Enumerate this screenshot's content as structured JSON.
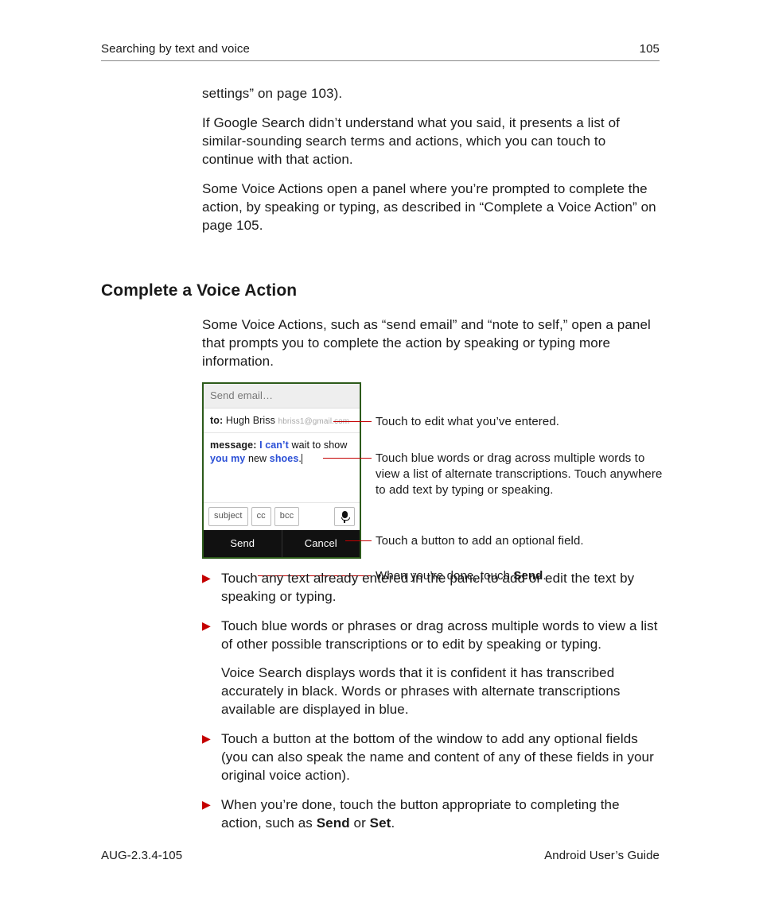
{
  "header": {
    "section": "Searching by text and voice",
    "page_number": "105"
  },
  "intro": {
    "p1": "settings” on page 103).",
    "p2": "If Google Search didn’t understand what you said, it presents a list of similar-sounding search terms and actions, which you can touch to continue with that action.",
    "p3": "Some Voice Actions open a panel where you’re prompted to complete the action, by speaking or typing, as described in “Complete a Voice Action” on page 105."
  },
  "section": {
    "title": "Complete a Voice Action",
    "lead": "Some Voice Actions, such as “send email” and “note to self,” open a panel that prompts you to complete the action by speaking or typing more information."
  },
  "panel": {
    "title": "Send email…",
    "to_label": "to:",
    "to_name": "Hugh Briss",
    "to_email": "hbriss1@gmail.com",
    "msg_label": "message:",
    "msg_w1": "I can’t",
    "msg_w2": "wait to show",
    "msg_w3": "you my",
    "msg_w4": "new",
    "msg_w5": "shoes",
    "chip_subject": "subject",
    "chip_cc": "cc",
    "chip_bcc": "bcc",
    "btn_send": "Send",
    "btn_cancel": "Cancel"
  },
  "callouts": {
    "c1": "Touch to edit what you’ve entered.",
    "c2": "Touch blue words or drag across multiple words to view a list of alternate transcriptions. Touch anywhere to add text by typing or speaking.",
    "c3": "Touch a button to add an optional field.",
    "c4_pre": "When you’re done, touch ",
    "c4_bold": "Send",
    "c4_post": "."
  },
  "bullets": {
    "b1": "Touch any text already entered in the panel to add or edit the text by speaking or typing.",
    "b2": "Touch blue words or phrases or drag across multiple words to view a list of other possible transcriptions or to edit by speaking or typing.",
    "b2b": "Voice Search displays words that it is confident it has transcribed accurately in black. Words or phrases with alternate transcriptions available are displayed in blue.",
    "b3": "Touch a button at the bottom of the window to add any optional fields (you can also speak the name and content of any of these fields in your original voice action).",
    "b4_pre": "When you’re done, touch the button appropriate to completing the action, such as ",
    "b4_s1": "Send",
    "b4_or": " or ",
    "b4_s2": "Set",
    "b4_post": "."
  },
  "footer": {
    "left": "AUG-2.3.4-105",
    "right": "Android User’s Guide"
  }
}
